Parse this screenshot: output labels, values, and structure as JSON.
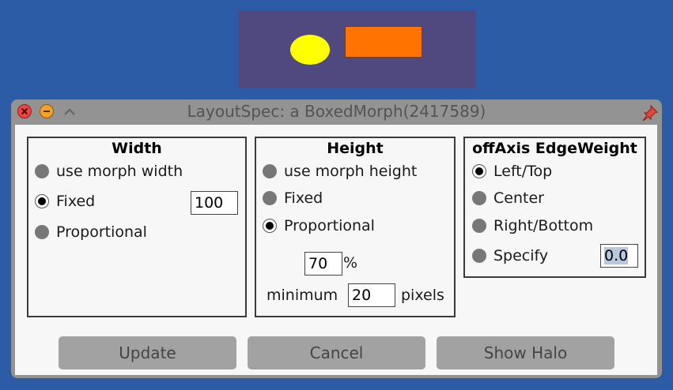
{
  "window": {
    "title": "LayoutSpec: a BoxedMorph(2417589)"
  },
  "width_panel": {
    "title": "Width",
    "options": [
      {
        "label": "use morph width",
        "selected": false
      },
      {
        "label": "Fixed",
        "selected": true
      },
      {
        "label": "Proportional",
        "selected": false
      }
    ],
    "fixed_value": "100"
  },
  "height_panel": {
    "title": "Height",
    "options": [
      {
        "label": "use morph height",
        "selected": false
      },
      {
        "label": "Fixed",
        "selected": false
      },
      {
        "label": "Proportional",
        "selected": true
      }
    ],
    "proportional_value": "70",
    "percent_sign": "%",
    "minimum_label": "minimum",
    "minimum_value": "20",
    "pixels_label": "pixels"
  },
  "edge_panel": {
    "title": "offAxis EdgeWeight",
    "options": [
      {
        "label": "Left/Top",
        "selected": true
      },
      {
        "label": "Center",
        "selected": false
      },
      {
        "label": "Right/Bottom",
        "selected": false
      },
      {
        "label": "Specify",
        "selected": false
      }
    ],
    "specify_value": "0.0"
  },
  "buttons": {
    "update": "Update",
    "cancel": "Cancel",
    "show_halo": "Show Halo"
  },
  "colors": {
    "desktop": "#2d5ca6",
    "morph_fill": "#4f4980",
    "ellipse": "#ffff00",
    "rectangle": "#ff7300"
  }
}
